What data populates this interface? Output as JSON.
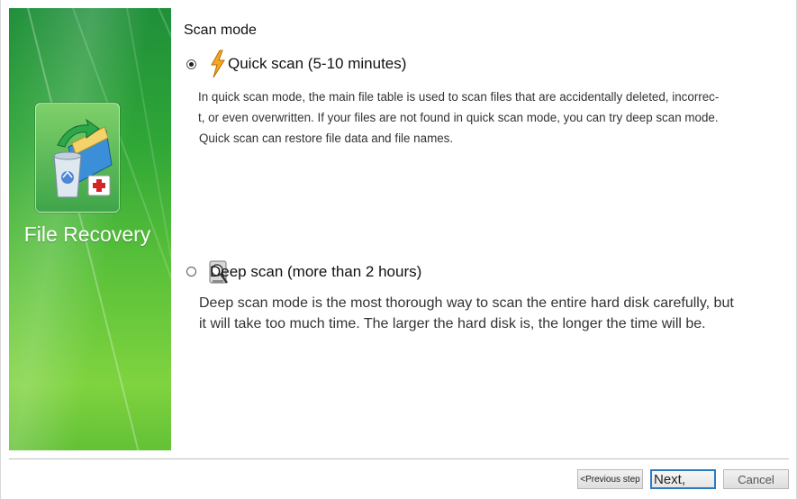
{
  "banner": {
    "title": "File Recovery",
    "icon": "file-recovery-icon"
  },
  "scan_mode": {
    "section_title": "Scan mode",
    "options": [
      {
        "label": "Quick scan (5-10 minutes)",
        "icon": "lightning-bolt-icon",
        "selected": true,
        "description_lines": [
          "In quick scan mode, the main file table is used to scan files that are accidentally deleted, incorrec-",
          "t, or even overwritten. If your files are not found in quick scan mode, you can try deep scan mode.",
          "Quick scan can restore file data and file names."
        ]
      },
      {
        "label": "Deep scan (more than 2 hours)",
        "icon": "magnifier-disk-icon",
        "selected": false,
        "description_lines": [
          "Deep scan mode is the most thorough way to scan the entire hard disk carefully, but",
          "it will take too much time. The larger the hard disk is, the longer the time will be."
        ]
      }
    ]
  },
  "buttons": {
    "previous": "<Previous step",
    "next": "Next,",
    "cancel": "Cancel"
  },
  "colors": {
    "banner_green": "#3fae3a",
    "focus_blue": "#2b7bc0"
  }
}
